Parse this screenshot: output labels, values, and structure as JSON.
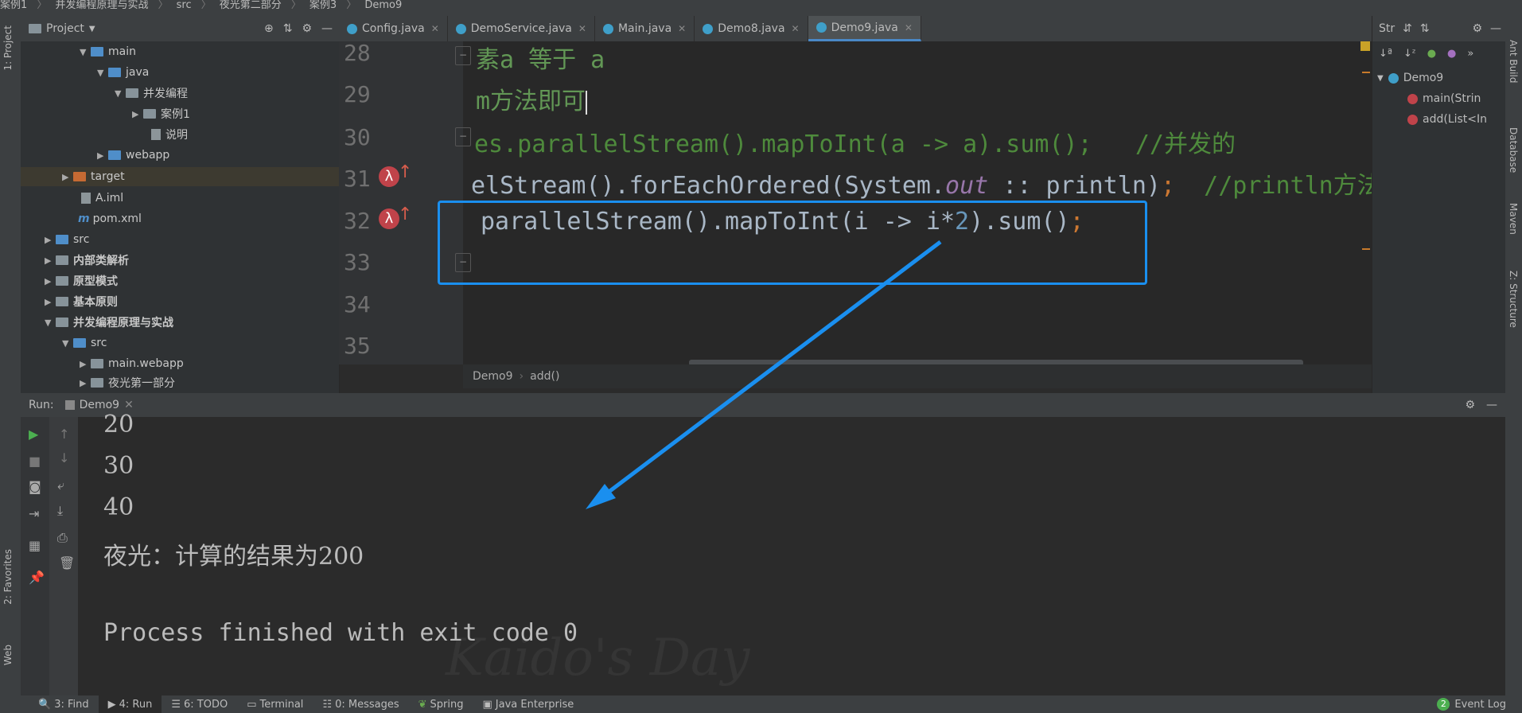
{
  "breadcrumb": [
    "案例1",
    "并发编程原理与实战",
    "src",
    "夜光第二部分",
    "案例3",
    "Demo9"
  ],
  "left_tabs": [
    "1: Project",
    "2: Favorites",
    "Web"
  ],
  "project": {
    "title": "Project",
    "tree": [
      {
        "label": "main"
      },
      {
        "label": "java"
      },
      {
        "label": "并发编程"
      },
      {
        "label": "案例1"
      },
      {
        "label": "说明"
      },
      {
        "label": "webapp"
      },
      {
        "label": "target"
      },
      {
        "label": "A.iml"
      },
      {
        "label": "pom.xml"
      },
      {
        "label": "src"
      },
      {
        "label": "内部类解析"
      },
      {
        "label": "原型模式"
      },
      {
        "label": "基本原则"
      },
      {
        "label": "并发编程原理与实战"
      },
      {
        "label": "src"
      },
      {
        "label": "main.webapp"
      },
      {
        "label": "夜光第一部分"
      }
    ]
  },
  "tabs": [
    "Config.java",
    "DemoService.java",
    "Main.java",
    "Demo8.java",
    "Demo9.java"
  ],
  "active_tab": "Demo9.java",
  "editor": {
    "line_numbers": [
      "28",
      "29",
      "30",
      "31",
      "32",
      "33",
      "34",
      "35"
    ],
    "lines": {
      "l28": "素a 等于 a",
      "l29": "m方法即可",
      "l30_code": "es.parallelStream().mapToInt(a -> a).sum();",
      "l30_comment": "//并发的",
      "l31_a": "elStream().forEachOrdered(System.",
      "l31_out": "out",
      "l31_b": " :: println)",
      "l31_semi": ";",
      "l31_comment": "//println方法",
      "l32_a": "parallelStream().mapToInt(i -> i*",
      "l32_num": "2",
      "l32_b": ").sum()",
      "l32_semi": ";"
    },
    "crumb_class": "Demo9",
    "crumb_method": "add()"
  },
  "structure": {
    "title": "Str",
    "class_name": "Demo9",
    "methods": [
      "main(Strin",
      "add(List<In"
    ]
  },
  "right_tabs": [
    "Ant Build",
    "Database",
    "Maven",
    "Z: Structure"
  ],
  "run": {
    "label": "Run:",
    "config": "Demo9",
    "output": [
      "20",
      "30",
      "40",
      "夜光：计算的结果为200",
      "",
      "Process finished with exit code 0"
    ],
    "watermark": "Kaido's Day"
  },
  "bottom_tabs": [
    "3: Find",
    "4: Run",
    "6: TODO",
    "Terminal",
    "0: Messages",
    "Spring",
    "Java Enterprise"
  ],
  "active_bottom_tab": "4: Run",
  "event_log": {
    "badge": "2",
    "label": "Event Log"
  },
  "colors": {
    "highlight": "#1a8fef",
    "accent": "#4a88c7",
    "comment": "#629755"
  }
}
